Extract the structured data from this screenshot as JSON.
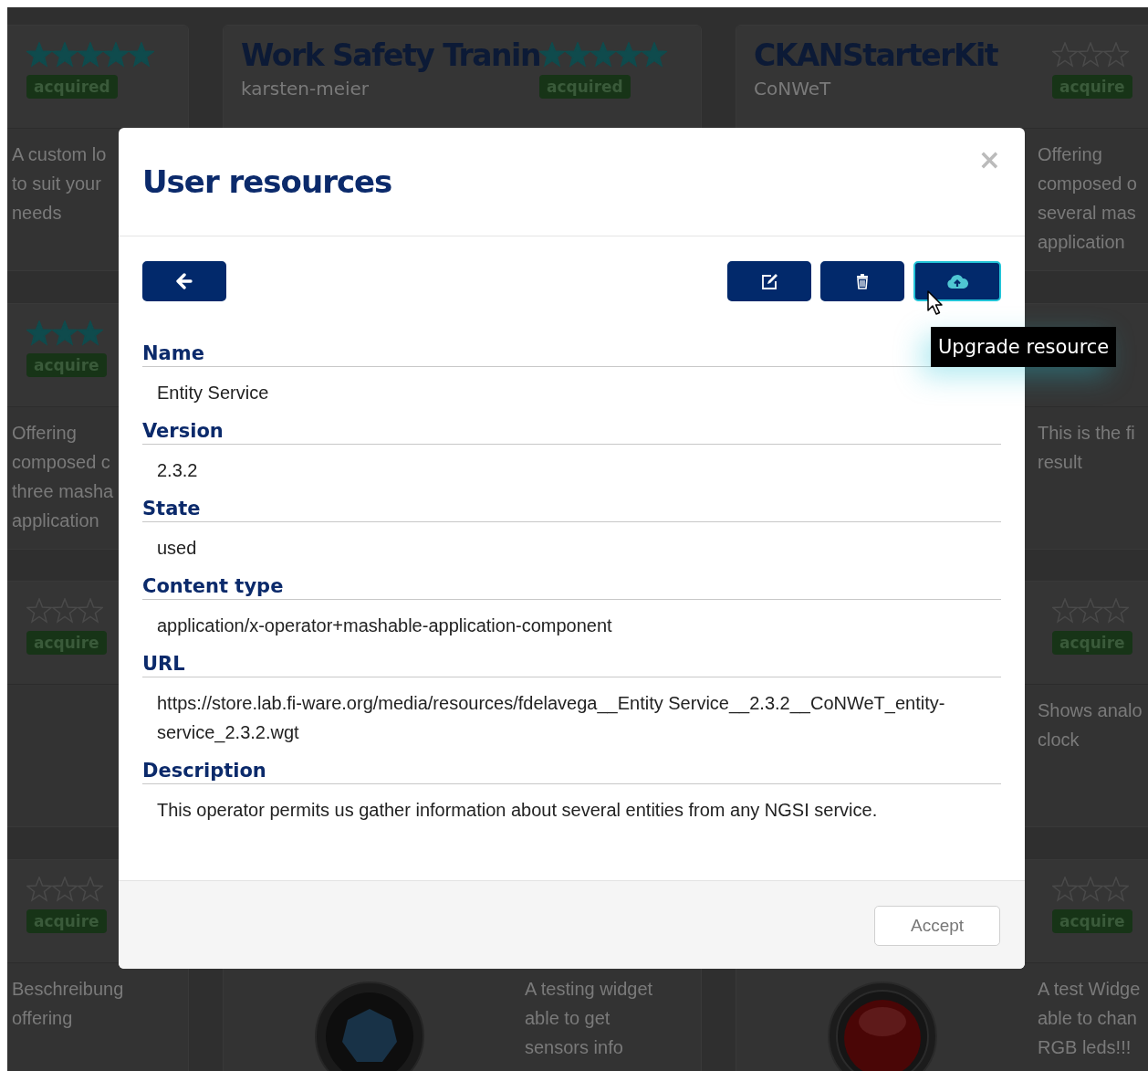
{
  "background_cards": [
    {
      "kind": "plain",
      "stars": 5,
      "badge": "acquired",
      "description_lines": [
        "A custom lo",
        "to suit your",
        "needs"
      ]
    },
    {
      "kind": "plain",
      "title": "Work Safety Tranin",
      "publisher": "karsten-meier",
      "stars": 5,
      "badge": "acquired"
    },
    {
      "kind": "plain",
      "title": "CKANStarterKit",
      "publisher": "CoNWeT",
      "stars": 0,
      "badge": "acquire",
      "description_lines": [
        "Offering",
        "composed o",
        "several mas",
        "application"
      ]
    },
    {
      "kind": "plain",
      "stars": 3,
      "badge": "acquire",
      "description_lines": [
        "Offering",
        "composed c",
        "three masha",
        "application"
      ]
    },
    {
      "kind": "plain",
      "description_lines": [
        "This is the fi",
        "result"
      ]
    },
    {
      "kind": "plain",
      "stars": 0,
      "badge": "acquire"
    },
    {
      "kind": "plain",
      "stars": 0,
      "badge": "acquire",
      "description_lines": [
        "Shows analo",
        "clock"
      ]
    },
    {
      "kind": "plain",
      "stars": 0,
      "badge": "acquire",
      "description_lines": [
        "Beschreibung",
        "offering"
      ]
    },
    {
      "kind": "lens",
      "description_lines": [
        "A testing widget",
        "able to get",
        "sensors info"
      ]
    },
    {
      "kind": "button",
      "stars": 0,
      "badge": "acquire",
      "description_lines": [
        "A test Widge",
        "able to chan",
        "RGB leds!!!"
      ]
    }
  ],
  "dialog": {
    "title": "User resources",
    "close": "×",
    "toolbar": [
      {
        "kind": "back",
        "hovered": false
      },
      {
        "kind": "edit",
        "hovered": false
      },
      {
        "kind": "delete",
        "hovered": false
      },
      {
        "kind": "upgrade",
        "hovered": true
      }
    ],
    "fields": [
      {
        "label": "Name",
        "value": "Entity Service"
      },
      {
        "label": "Version",
        "value": "2.3.2"
      },
      {
        "label": "State",
        "value": "used"
      },
      {
        "label": "Content type",
        "value": "application/x-operator+mashable-application-component"
      },
      {
        "label": "URL",
        "value": "https://store.lab.fi-ware.org/media/resources/fdelavega__Entity Service__2.3.2__CoNWeT_entity-service_2.3.2.wgt"
      },
      {
        "label": "Description",
        "value": "This operator permits us gather information about several entities from any NGSI service."
      }
    ],
    "footer_button": "Accept"
  },
  "tooltip": "Upgrade resource"
}
